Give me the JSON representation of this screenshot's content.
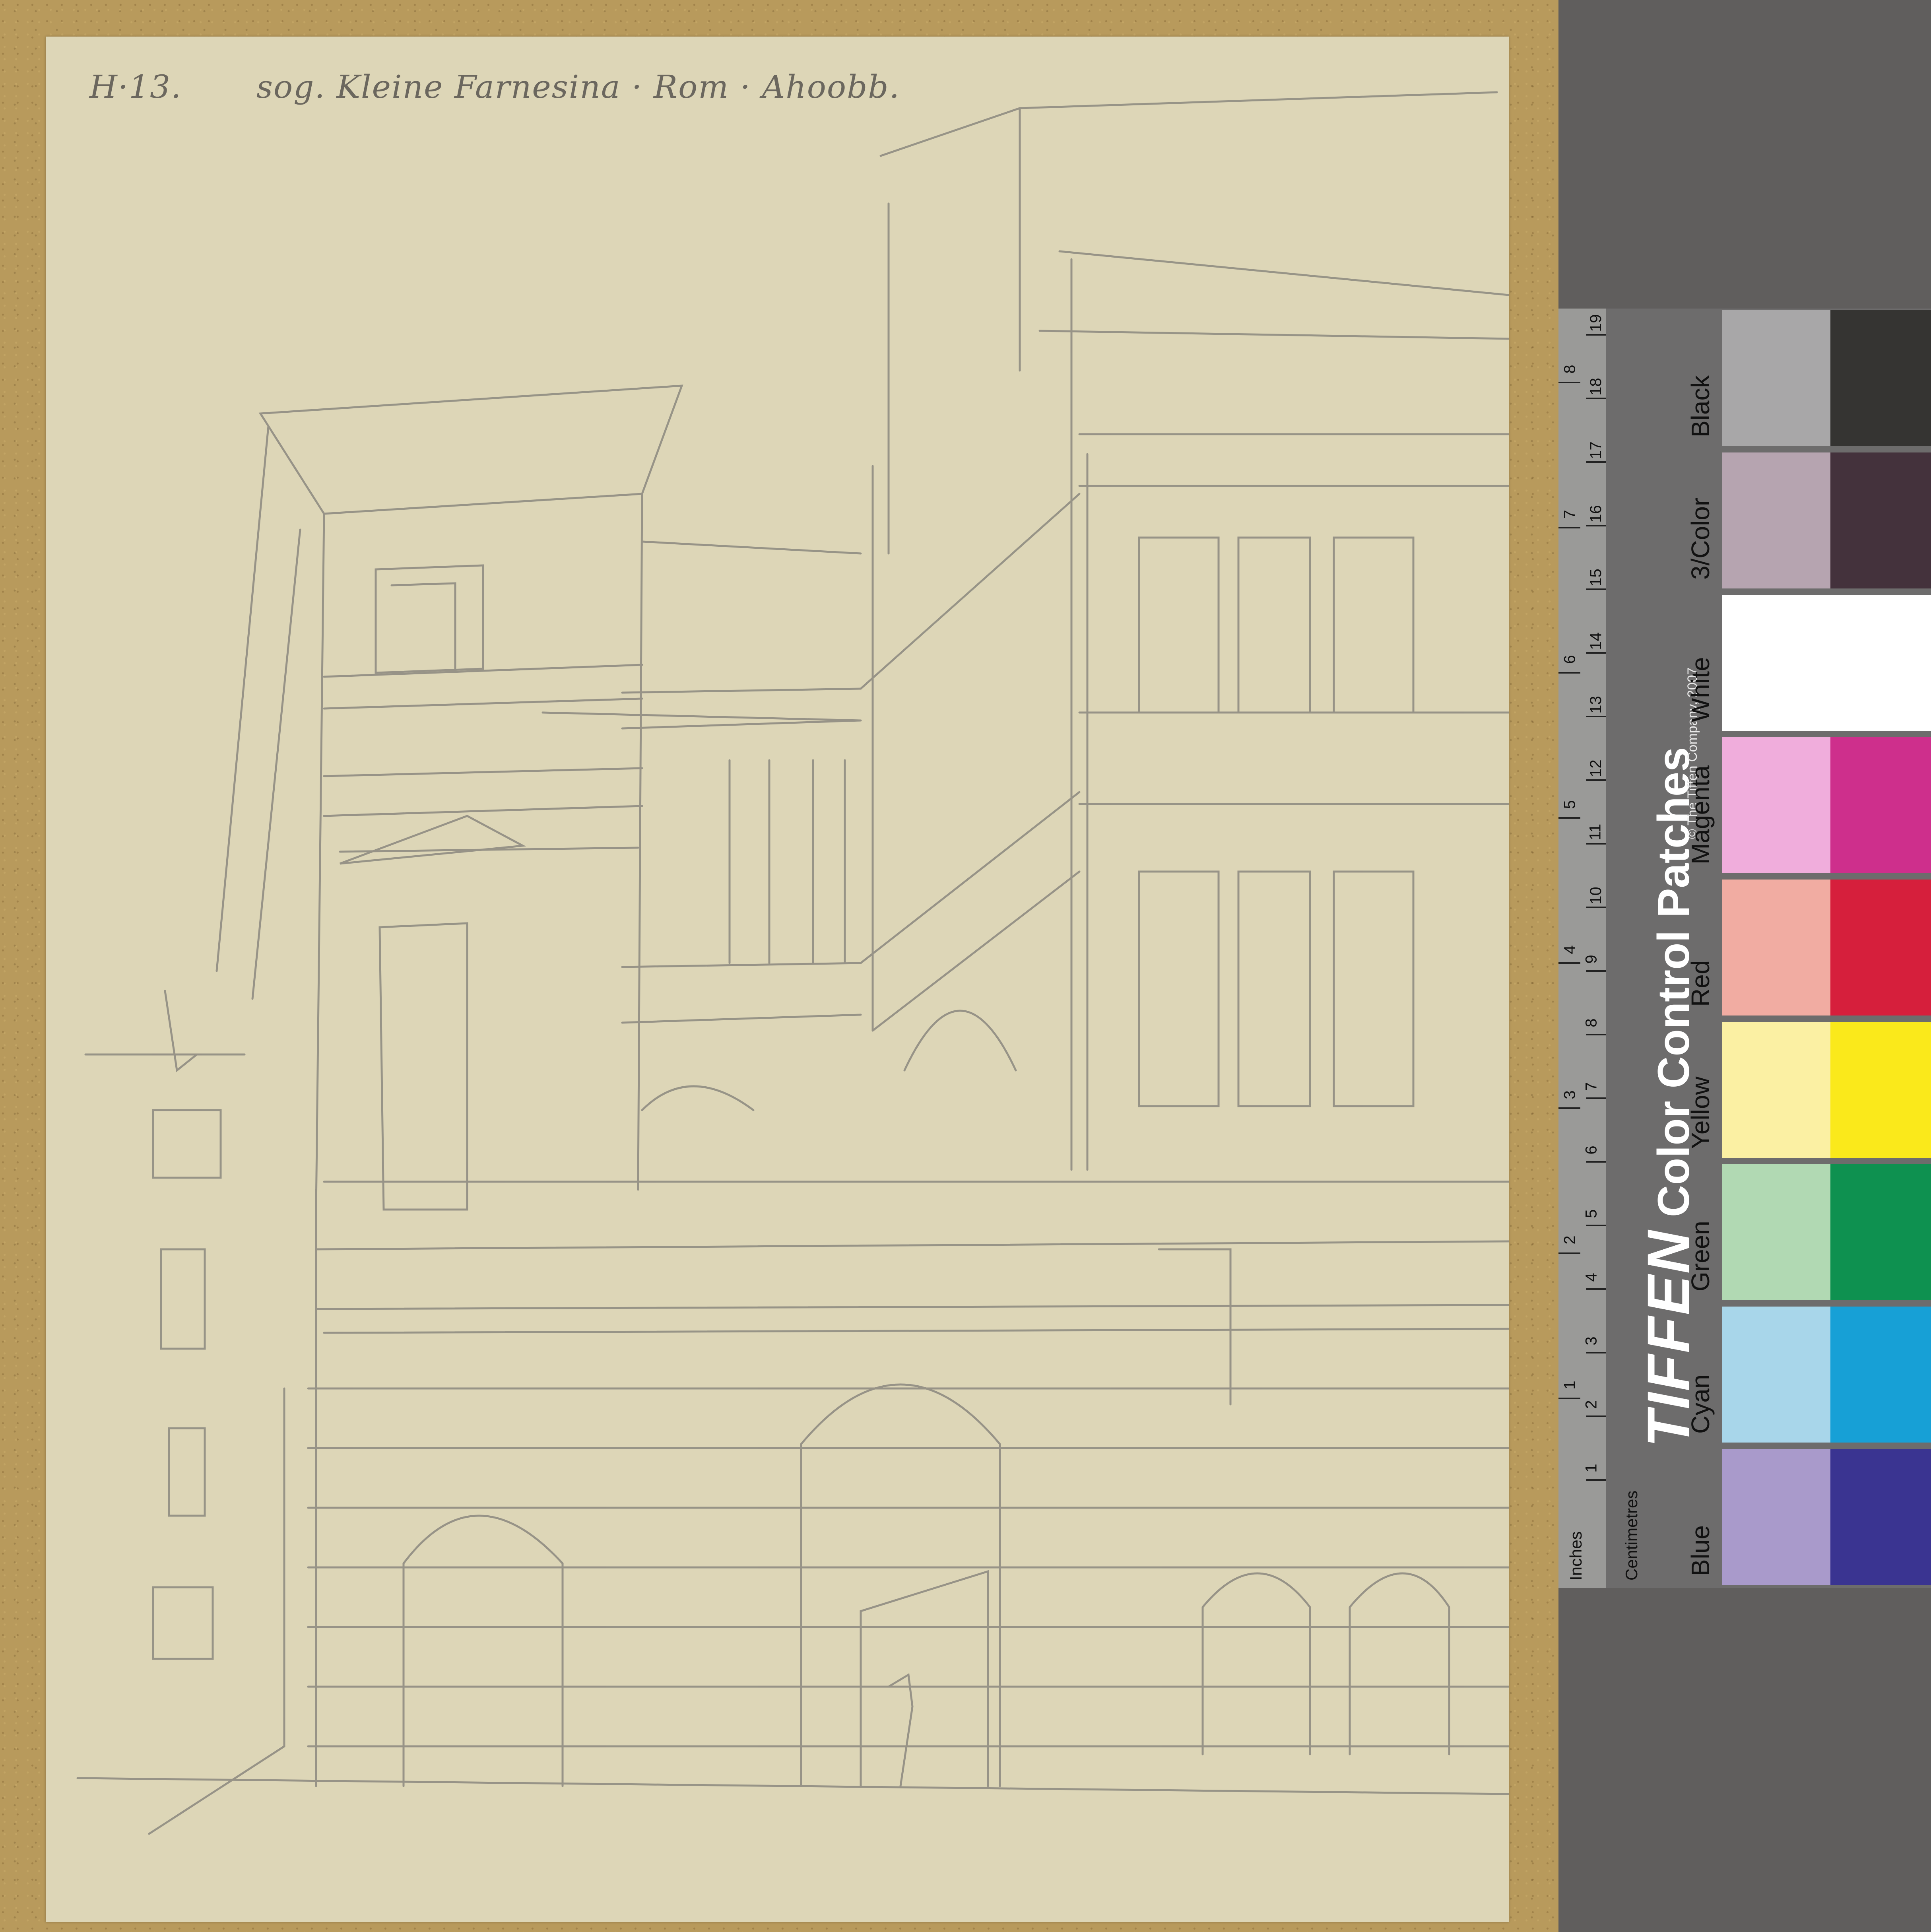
{
  "inscriptions": {
    "inventory_number": "H·13.",
    "title": "sog. Kleine Farnesina · Rom · Ahoobb."
  },
  "color_card": {
    "brand": "TIFFEN",
    "title": "Color Control Patches",
    "copyright": "© The Tiffen Company, 2007",
    "ruler_units_inches": "Inches",
    "ruler_units_cm": "Centimetres",
    "inch_marks": [
      "1",
      "2",
      "3",
      "4",
      "5",
      "6",
      "7",
      "8"
    ],
    "cm_marks": [
      "1",
      "2",
      "3",
      "4",
      "5",
      "6",
      "7",
      "8",
      "9",
      "10",
      "11",
      "12",
      "13",
      "14",
      "15",
      "16",
      "17",
      "18",
      "19"
    ],
    "patches": [
      {
        "label": "Blue",
        "light": "#a99acb",
        "dark": "#3a3491"
      },
      {
        "label": "Cyan",
        "light": "#a8d6ea",
        "dark": "#17a0d6"
      },
      {
        "label": "Green",
        "light": "#b1d9b3",
        "dark": "#0e9150"
      },
      {
        "label": "Yellow",
        "light": "#fbf0a3",
        "dark": "#fae91b"
      },
      {
        "label": "Red",
        "light": "#f1aca2",
        "dark": "#d61f3c"
      },
      {
        "label": "Magenta",
        "light": "#f0addc",
        "dark": "#ce2f8c"
      },
      {
        "label": "White",
        "light": "#ffffff",
        "dark": "#ffffff"
      },
      {
        "label": "3/Color",
        "light": "#b6a4b0",
        "dark": "#44323c"
      },
      {
        "label": "Black",
        "light": "#a8a7a8",
        "dark": "#353432"
      }
    ]
  }
}
